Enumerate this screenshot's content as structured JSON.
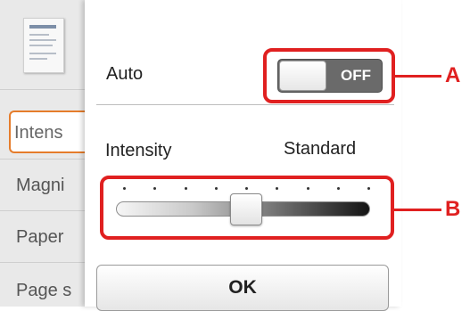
{
  "sidebar": {
    "items": [
      {
        "label": "Intens",
        "active": true
      },
      {
        "label": "Magni"
      },
      {
        "label": "Paper"
      },
      {
        "label": "Page s"
      }
    ]
  },
  "auto": {
    "label": "Auto",
    "toggle_state": "OFF"
  },
  "intensity": {
    "label": "Intensity",
    "value_label": "Standard",
    "steps": 9,
    "position_index": 4
  },
  "ok_button": {
    "label": "OK"
  },
  "callouts": {
    "a": "A",
    "b": "B"
  },
  "colors": {
    "accent": "#e57c2b",
    "callout": "#e02020",
    "toggle_off": "#6a6a6a"
  }
}
